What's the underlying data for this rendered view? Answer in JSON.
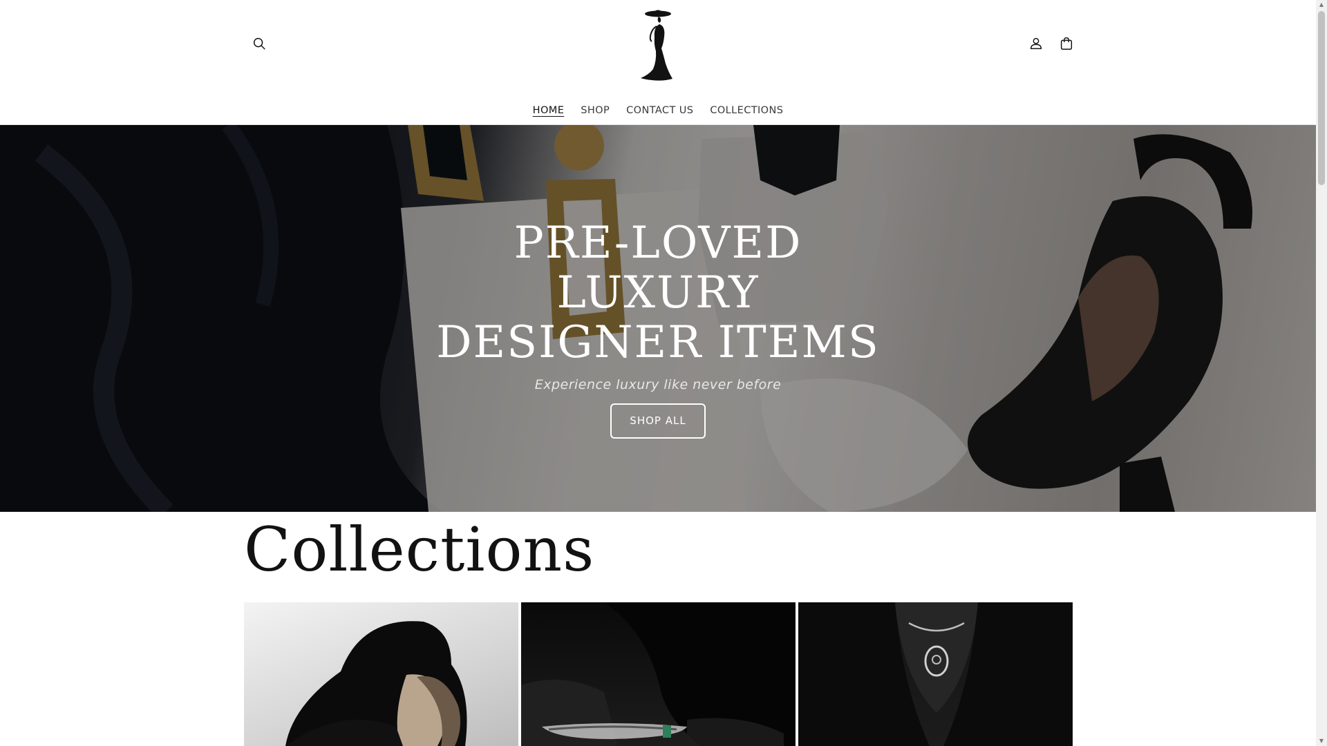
{
  "header": {
    "icons": {
      "search": "search-icon",
      "account": "account-icon",
      "cart": "cart-icon",
      "logo": "woman-silhouette-logo"
    },
    "nav": [
      {
        "label": "HOME",
        "active": true
      },
      {
        "label": "SHOP",
        "active": false
      },
      {
        "label": "CONTACT US",
        "active": false
      },
      {
        "label": "COLLECTIONS",
        "active": false
      }
    ]
  },
  "hero": {
    "title_lines": [
      "PRE-LOVED",
      "LUXURY",
      "DESIGNER ITEMS"
    ],
    "subtitle": "Experience luxury like never before",
    "button_label": "SHOP ALL"
  },
  "collections": {
    "heading": "Collections"
  },
  "colors": {
    "text": "#121212",
    "background": "#ffffff",
    "hero_overlay": "rgba(0,0,0,0.38)"
  }
}
